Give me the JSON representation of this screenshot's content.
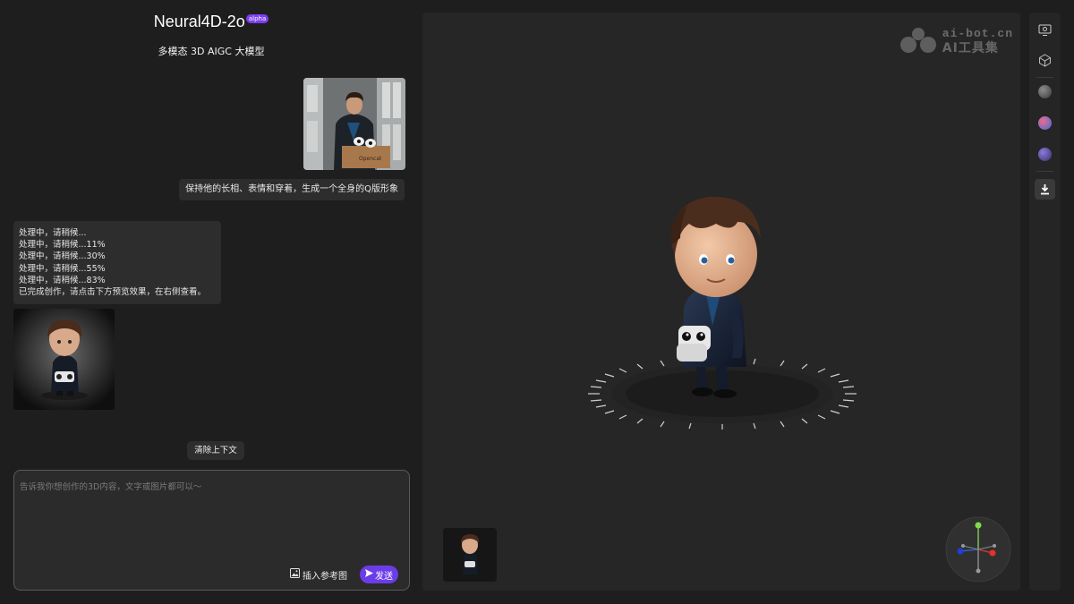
{
  "app": {
    "title": "Neural4D-2o",
    "badge": "alpha",
    "subtitle": "多模态 3D AIGC 大模型"
  },
  "conversation": {
    "user_message": "保持他的长相、表情和穿着，生成一个全身的Q版形象",
    "bot_status_lines": [
      "处理中，请稍候...",
      "处理中，请稍候...11%",
      "处理中，请稍候...30%",
      "处理中，请稍候...55%",
      "处理中，请稍候...83%",
      "已完成创作，请点击下方预览效果，在右侧查看。"
    ],
    "clear_label": "清除上下文"
  },
  "composer": {
    "placeholder": "告诉我你想创作的3D内容，文字或图片都可以～",
    "insert_ref_label": "插入参考图",
    "send_label": "发送"
  },
  "watermark": {
    "line1": "ai-bot.cn",
    "line2": "AI工具集"
  },
  "toolbar": {
    "items": [
      "monitor-icon",
      "wireframe-icon",
      "matte-sphere-icon",
      "gradient-sphere-icon",
      "purple-sphere-icon",
      "download-icon"
    ]
  },
  "colors": {
    "accent": "#6c3ce9",
    "badge": "#7b3ff2",
    "panel": "#262626",
    "background": "#1e1e1e"
  }
}
